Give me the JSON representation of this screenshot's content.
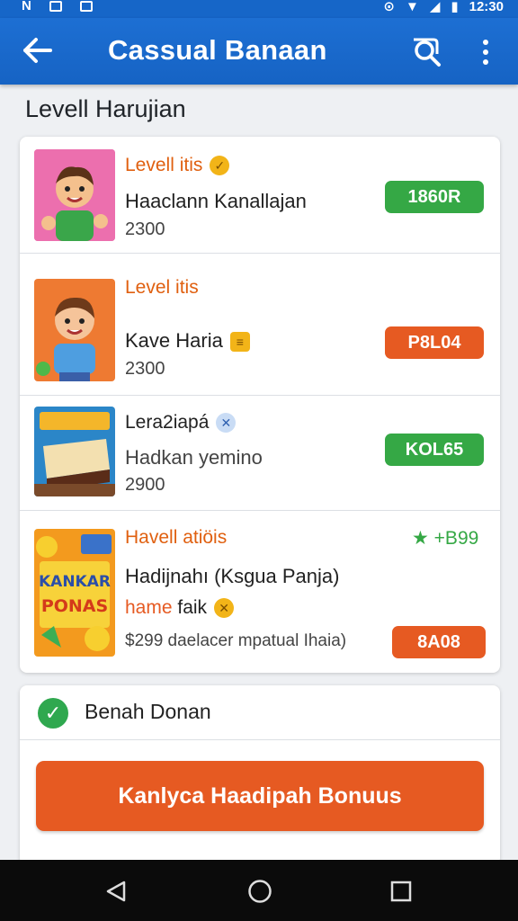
{
  "status_bar": {
    "left_letter": "N",
    "time": "12:30"
  },
  "app_bar": {
    "title": "Cassual Banaan"
  },
  "section_title": "Levell Harujian",
  "items": [
    {
      "level": "Levell itis",
      "name": "Haaclann Kanallajan",
      "sub": "2300",
      "price": "1860R",
      "price_color": "#35a845",
      "badge_icon": "gold-medal-icon"
    },
    {
      "level": "Level itis",
      "name": "Kave Haria",
      "sub": "2300",
      "price": "P8L04",
      "price_color": "#e65a22",
      "badge_icon": "gold-coin-icon"
    },
    {
      "level": "Lera2iapá",
      "name": "Hadkan yemino",
      "sub": "2900",
      "price": "KOL65",
      "price_color": "#35a845",
      "badge_icon": "blue-star-badge-icon"
    },
    {
      "level": "Havell atiöis",
      "name": "Hadijnahı (Ksgua Panja)",
      "sub_prefix": "hame",
      "sub_suffix": "faik",
      "detail": "$299 daelacer mpatual Ihaia)",
      "price": "8A08",
      "price_color": "#e65a22",
      "rating": "+B99",
      "badge_icon": "gold-medal-icon",
      "thumb_text_1": "KANKAR",
      "thumb_text_2": "PONAS"
    }
  ],
  "checkbox_label": "Benah Donan",
  "cta_label": "Kanlyca Haadipah Bonuus"
}
